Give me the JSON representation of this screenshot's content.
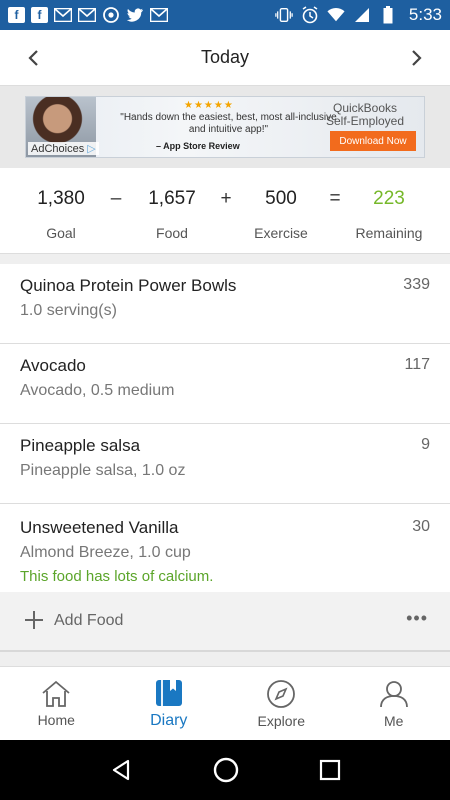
{
  "status_bar": {
    "time": "5:33",
    "left_icons": [
      "facebook-icon",
      "facebook-icon",
      "gmail-icon",
      "gmail-icon",
      "chrome-icon",
      "twitter-icon",
      "gmail-icon"
    ],
    "right_icons": [
      "vibrate-icon",
      "alarm-icon",
      "wifi-icon",
      "signal-icon",
      "battery-icon"
    ]
  },
  "header": {
    "title": "Today"
  },
  "ad": {
    "stars": "★★★★★",
    "quote": "\"Hands down the easiest, best, most all-inclusive and intuitive app!\"",
    "source": "– App Store Review",
    "brand": "QuickBooks Self-Employed",
    "cta": "Download Now",
    "choices": "AdChoices"
  },
  "summary": {
    "goal": {
      "value": "1,380",
      "label": "Goal"
    },
    "food": {
      "value": "1,657",
      "label": "Food"
    },
    "exercise": {
      "value": "500",
      "label": "Exercise"
    },
    "remaining": {
      "value": "223",
      "label": "Remaining"
    },
    "ops": {
      "minus": "–",
      "plus": "+",
      "equals": "="
    }
  },
  "foods": [
    {
      "name": "Quinoa Protein Power Bowls",
      "desc": "1.0 serving(s)",
      "cal": "339"
    },
    {
      "name": "Avocado",
      "desc": "Avocado, 0.5 medium",
      "cal": "117"
    },
    {
      "name": "Pineapple salsa",
      "desc": "Pineapple salsa, 1.0 oz",
      "cal": "9"
    },
    {
      "name": "Unsweetened Vanilla",
      "desc": "Almond Breeze, 1.0 cup",
      "cal": "30",
      "note": "This food has lots of calcium."
    }
  ],
  "add_food": {
    "label": "Add Food",
    "more": "•••"
  },
  "bottom_nav": [
    {
      "label": "Home",
      "icon": "home-icon"
    },
    {
      "label": "Diary",
      "icon": "diary-icon",
      "active": true
    },
    {
      "label": "Explore",
      "icon": "compass-icon"
    },
    {
      "label": "Me",
      "icon": "user-icon"
    }
  ],
  "colors": {
    "status_bar": "#1e5fa0",
    "accent": "#1a78c2",
    "green": "#76b82a"
  }
}
